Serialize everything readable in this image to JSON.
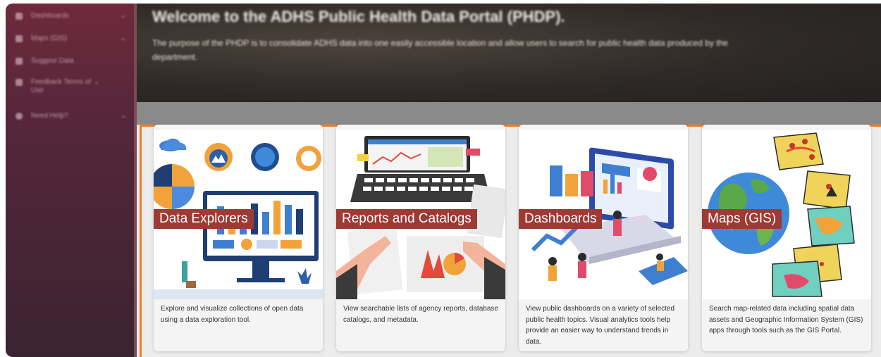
{
  "sidebar": {
    "items": [
      {
        "label": "Dashboards",
        "icon": "grid-icon",
        "has_chevron": true
      },
      {
        "label": "Maps (GIS)",
        "icon": "map-icon",
        "has_chevron": true
      },
      {
        "label": "Suggest Data",
        "icon": "lightbulb-icon",
        "has_chevron": false
      },
      {
        "label": "Feedback Terms of Use",
        "icon": "comment-icon",
        "has_chevron": true
      },
      {
        "label": "Need Help?",
        "icon": "help-icon",
        "has_chevron": true
      }
    ],
    "chevron": "⌄"
  },
  "hero": {
    "title": "Welcome to the ADHS Public Health Data Portal (PHDP).",
    "text": "The purpose of the PHDP is to consolidate ADHS data into one easily accessible location and allow users to search for public health data produced by the department."
  },
  "cards": [
    {
      "title": "Data Explorers",
      "description": "Explore and visualize collections of open data using a data exploration tool."
    },
    {
      "title": "Reports and Catalogs",
      "description": "View searchable lists of agency reports, database catalogs, and metadata."
    },
    {
      "title": "Dashboards",
      "description": "View public dashboards on a variety of selected public health topics. Visual analytics tools help provide an easier way to understand trends in data."
    },
    {
      "title": "Maps (GIS)",
      "description": "Search map-related data including spatial data assets and Geographic Information System (GIS) apps through tools such as the GIS Portal."
    }
  ],
  "colors": {
    "accent_orange": "#f07e26",
    "label_red": "#9c3a34",
    "sidebar": "#55263a"
  }
}
